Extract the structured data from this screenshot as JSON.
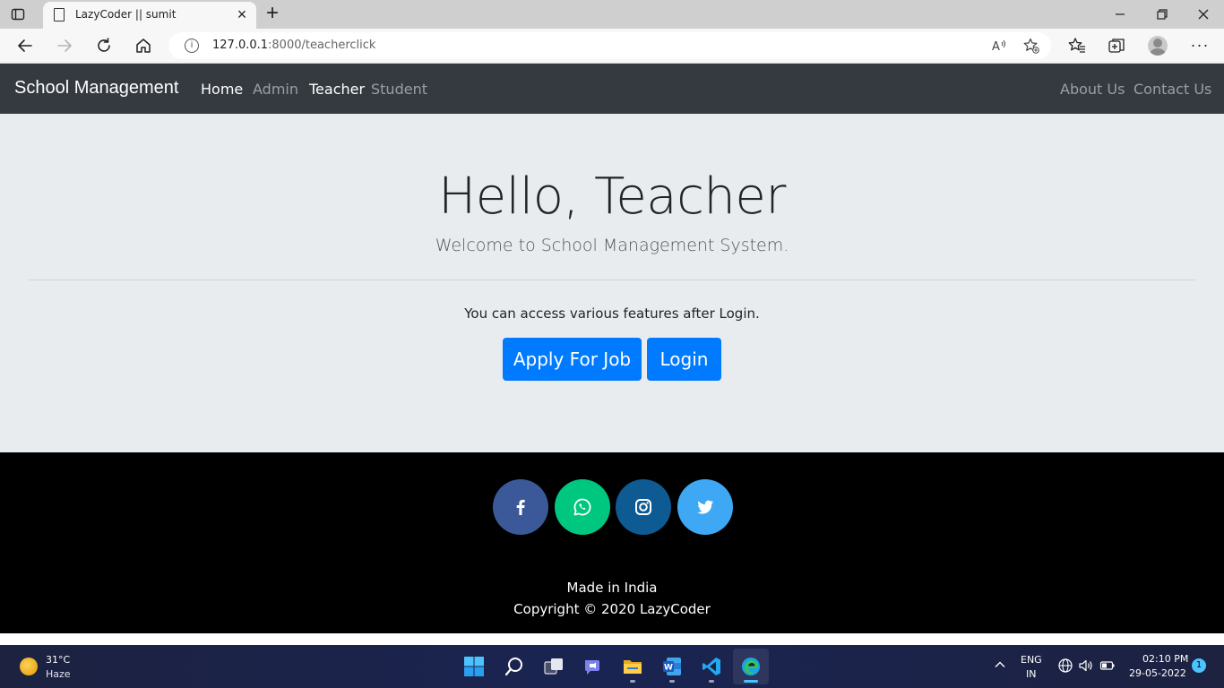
{
  "browser": {
    "tab_title": "LazyCoder || sumit",
    "url_host": "127.0.0.1",
    "url_path": ":8000/teacherclick"
  },
  "navbar": {
    "brand": "School Management",
    "links": [
      {
        "label": "Home",
        "active": true
      },
      {
        "label": "Admin",
        "active": false
      },
      {
        "label": "Teacher",
        "active": true
      },
      {
        "label": "Student",
        "active": false
      }
    ],
    "right_links": [
      {
        "label": "About Us"
      },
      {
        "label": "Contact Us"
      }
    ]
  },
  "hero": {
    "heading": "Hello, Teacher",
    "lead": "Welcome to School Management System.",
    "info": "You can access various features after Login.",
    "apply_button": "Apply For Job",
    "login_button": "Login"
  },
  "footer": {
    "social": [
      {
        "icon": "facebook-icon",
        "color": "#3b5998"
      },
      {
        "icon": "whatsapp-icon",
        "color": "#00c77f"
      },
      {
        "icon": "instagram-icon",
        "color": "#0e5a93"
      },
      {
        "icon": "twitter-icon",
        "color": "#3ea8f5"
      }
    ],
    "made_in": "Made in India",
    "copyright": "Copyright © 2020 LazyCoder"
  },
  "taskbar": {
    "weather_temp": "31°C",
    "weather_desc": "Haze",
    "lang_line1": "ENG",
    "lang_line2": "IN",
    "time": "02:10 PM",
    "date": "29-05-2022",
    "notification_count": "1"
  },
  "colors": {
    "navbar_bg": "#343a40",
    "jumbotron_bg": "#e9ecef",
    "primary_button": "#007bff",
    "footer_bg": "#000000"
  }
}
